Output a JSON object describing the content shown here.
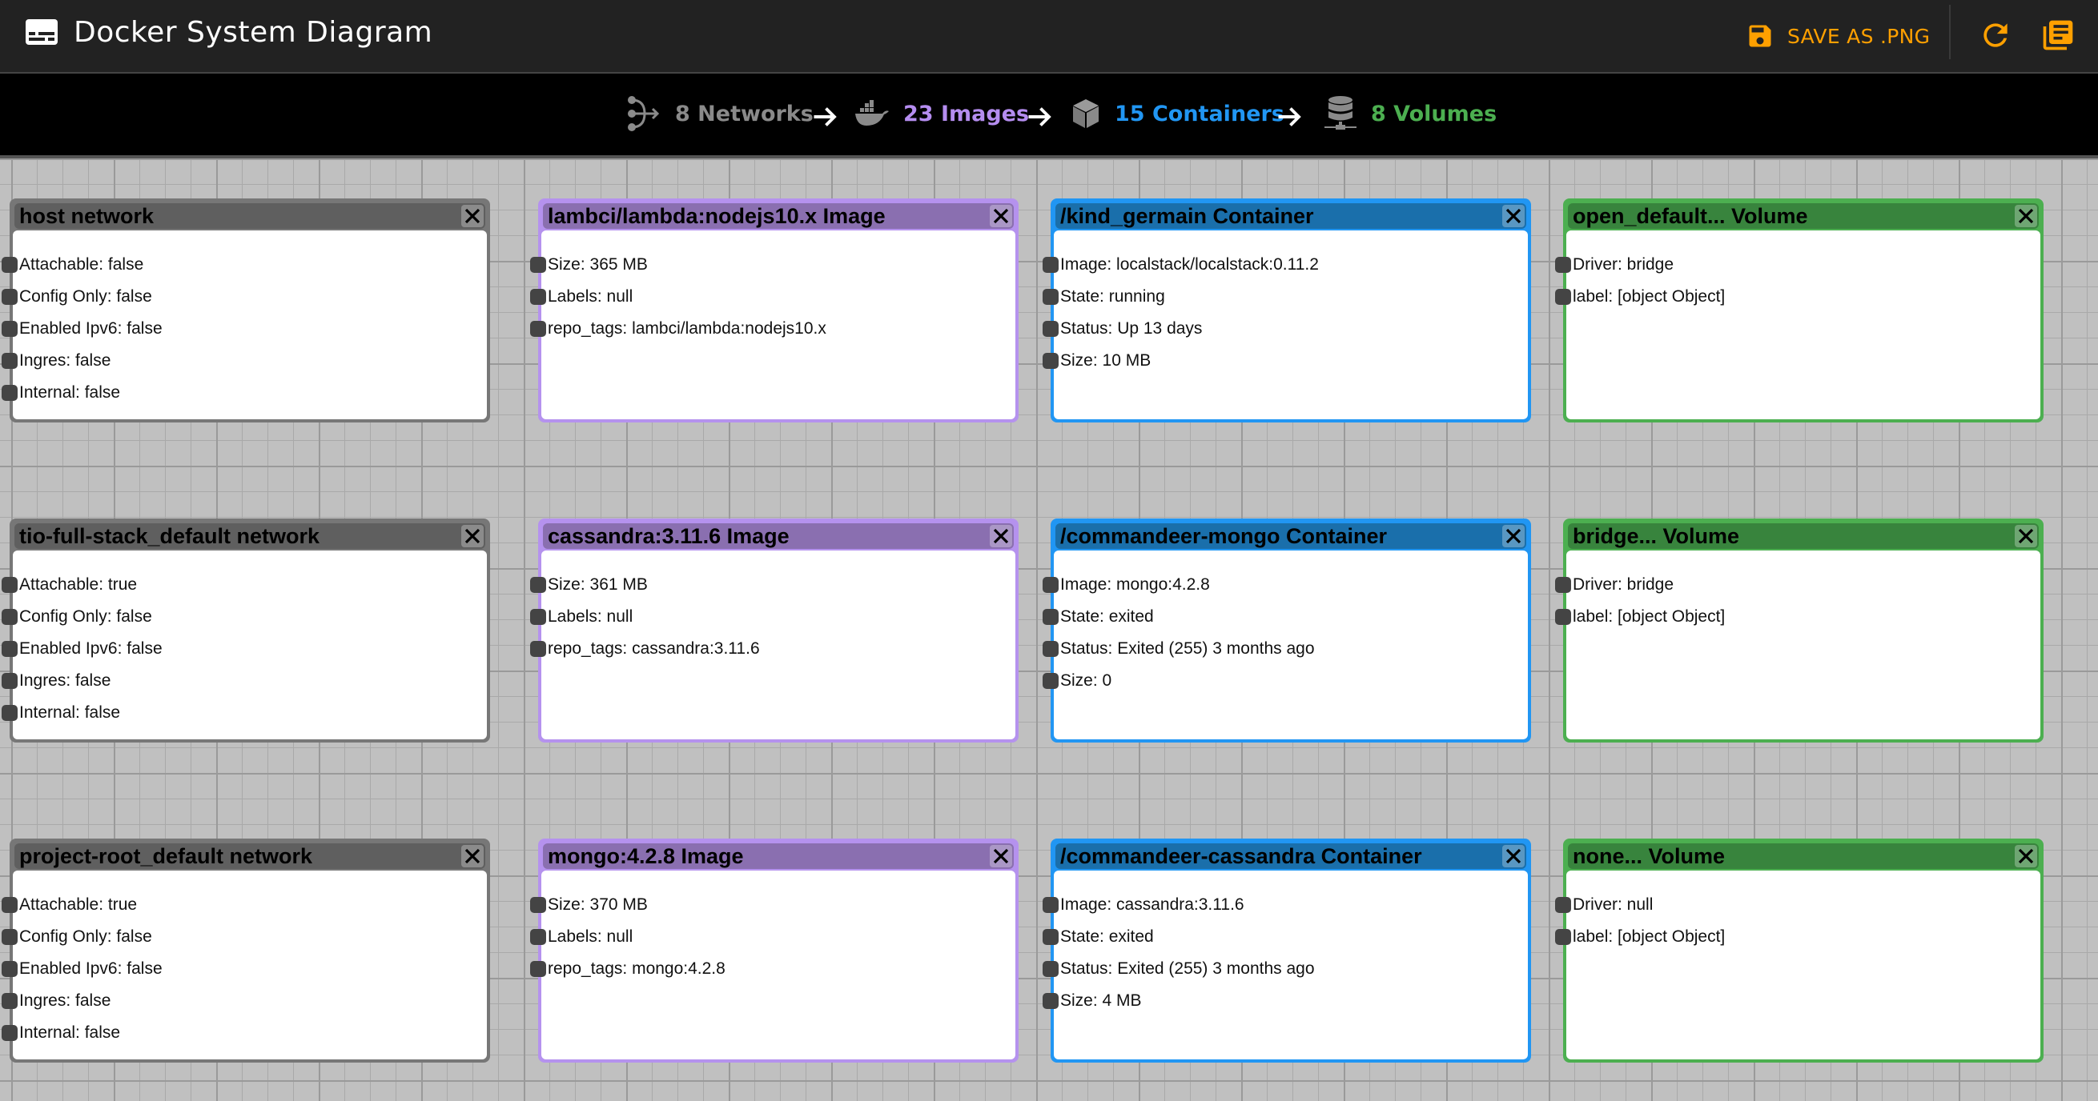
{
  "app": {
    "title": "Docker System Diagram",
    "title_icon": "subtitles-icon",
    "save_label": "SAVE AS .PNG",
    "accent_color": "#ffa000",
    "actions": [
      "save-icon",
      "refresh-icon",
      "library-icon"
    ]
  },
  "stats": [
    {
      "label": "8 Networks",
      "icon": "network-icon",
      "color": "#8a8a8a"
    },
    {
      "label": "23 Images",
      "icon": "docker-whale-icon",
      "color": "#b58df0"
    },
    {
      "label": "15 Containers",
      "icon": "cube-icon",
      "color": "#2196f3"
    },
    {
      "label": "8 Volumes",
      "icon": "database-icon",
      "color": "#4caf50"
    }
  ],
  "columns": {
    "networks": [
      {
        "title": "host network",
        "fields": [
          "Attachable: false",
          "Config Only: false",
          "Enabled Ipv6: false",
          "Ingres: false",
          "Internal: false"
        ]
      },
      {
        "title": "tio-full-stack_default network",
        "fields": [
          "Attachable: true",
          "Config Only: false",
          "Enabled Ipv6: false",
          "Ingres: false",
          "Internal: false"
        ]
      },
      {
        "title": "project-root_default network",
        "fields": [
          "Attachable: true",
          "Config Only: false",
          "Enabled Ipv6: false",
          "Ingres: false",
          "Internal: false"
        ]
      }
    ],
    "images": [
      {
        "title": "lambci/lambda:nodejs10.x Image",
        "fields": [
          "Size: 365 MB",
          "Labels: null",
          "repo_tags: lambci/lambda:nodejs10.x"
        ]
      },
      {
        "title": "cassandra:3.11.6 Image",
        "fields": [
          "Size: 361 MB",
          "Labels: null",
          "repo_tags: cassandra:3.11.6"
        ]
      },
      {
        "title": "mongo:4.2.8 Image",
        "fields": [
          "Size: 370 MB",
          "Labels: null",
          "repo_tags: mongo:4.2.8"
        ]
      }
    ],
    "containers": [
      {
        "title": "/kind_germain Container",
        "fields": [
          "Image: localstack/localstack:0.11.2",
          "State: running",
          "Status: Up 13 days",
          "Size: 10 MB"
        ]
      },
      {
        "title": "/commandeer-mongo Container",
        "fields": [
          "Image: mongo:4.2.8",
          "State: exited",
          "Status: Exited (255) 3 months ago",
          "Size: 0"
        ]
      },
      {
        "title": "/commandeer-cassandra Container",
        "fields": [
          "Image: cassandra:3.11.6",
          "State: exited",
          "Status: Exited (255) 3 months ago",
          "Size: 4 MB"
        ]
      }
    ],
    "volumes": [
      {
        "title": "open_default... Volume",
        "fields": [
          "Driver: bridge",
          "label: [object Object]"
        ]
      },
      {
        "title": "bridge... Volume",
        "fields": [
          "Driver: bridge",
          "label: [object Object]"
        ]
      },
      {
        "title": "none... Volume",
        "fields": [
          "Driver: null",
          "label: [object Object]"
        ]
      }
    ]
  },
  "close_label": "close"
}
